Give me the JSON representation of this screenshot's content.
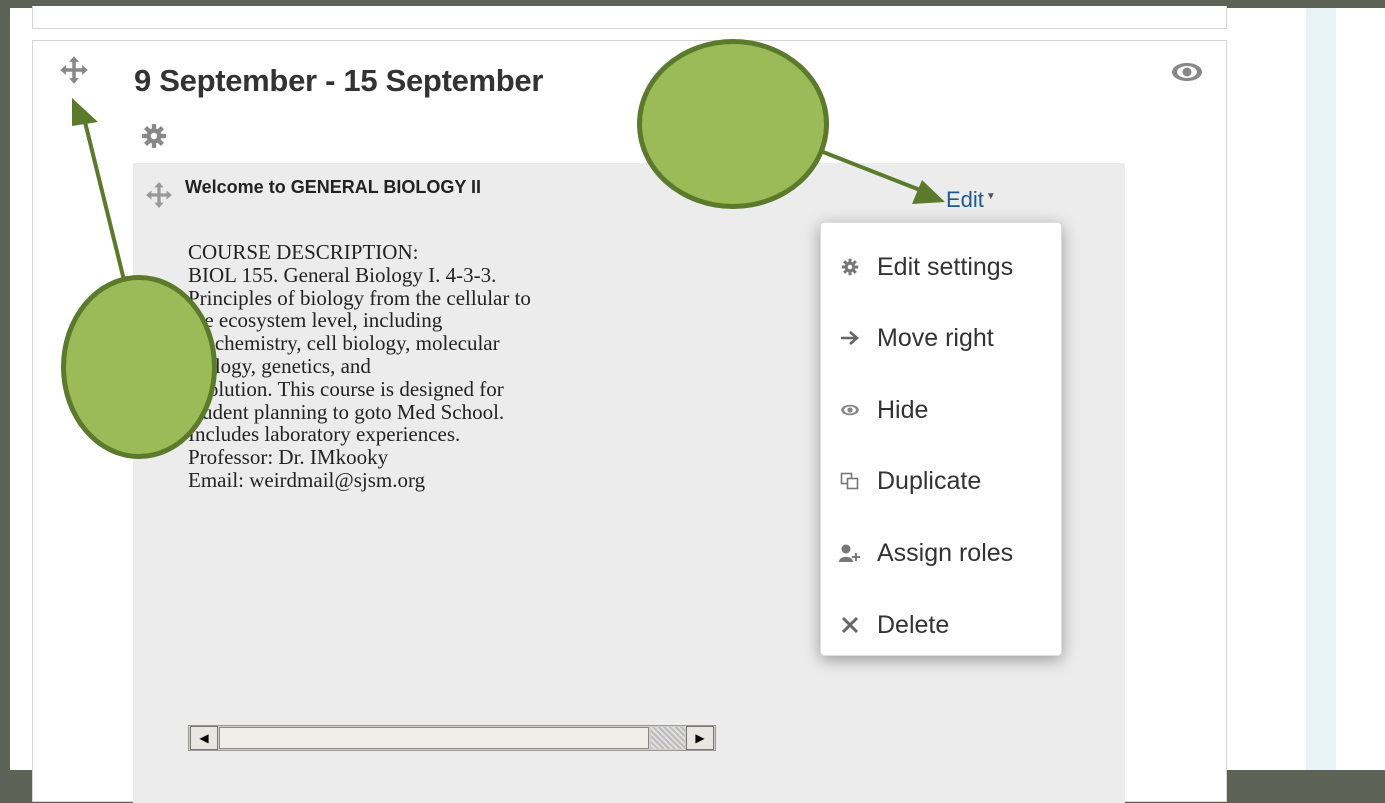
{
  "section": {
    "title": "9 September - 15 September"
  },
  "activity": {
    "name": "Welcome to GENERAL BIOLOGY II",
    "edit_label": "Edit",
    "description_lines": [
      "COURSE DESCRIPTION:",
      "BIOL 155. General Biology I. 4-3-3.",
      "Principles of biology from the cellular to",
      "the ecosystem level, including",
      "biochemistry, cell biology, molecular",
      "biology, genetics, and",
      "evolution. This course is designed for",
      "student planning to goto Med School.",
      "Includes laboratory experiences.",
      "Professor: Dr. IMkooky",
      "Email: weirdmail@sjsm.org"
    ]
  },
  "edit_menu": {
    "items": [
      {
        "label": "Edit settings",
        "icon": "gear-icon"
      },
      {
        "label": "Move right",
        "icon": "arrow-right-icon"
      },
      {
        "label": "Hide",
        "icon": "eye-icon"
      },
      {
        "label": "Duplicate",
        "icon": "duplicate-icon"
      },
      {
        "label": "Assign roles",
        "icon": "assign-roles-icon"
      },
      {
        "label": "Delete",
        "icon": "delete-icon"
      }
    ]
  },
  "colors": {
    "annotation_fill": "#9bbb59",
    "annotation_border": "#5b7a2c",
    "link": "#1d5a92",
    "activity_bg": "#ececec"
  }
}
